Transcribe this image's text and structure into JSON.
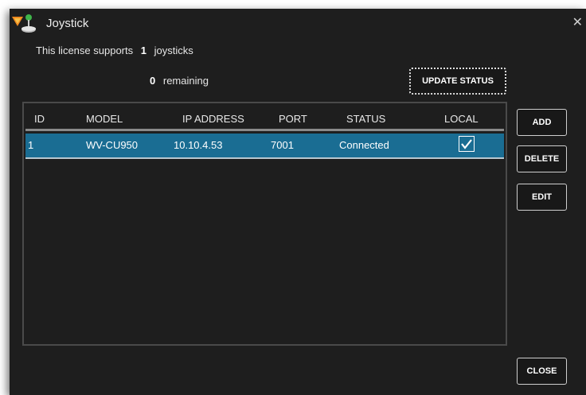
{
  "window": {
    "title": "Joystick",
    "close_glyph": "✕"
  },
  "license": {
    "supports_prefix": "This license supports",
    "supports_count": "1",
    "supports_suffix": "joysticks",
    "remaining_count": "0",
    "remaining_label": "remaining"
  },
  "buttons": {
    "update_status": "UPDATE STATUS",
    "add": "ADD",
    "delete": "DELETE",
    "edit": "EDIT",
    "close": "CLOSE"
  },
  "table": {
    "columns": [
      "ID",
      "MODEL",
      "IP ADDRESS",
      "PORT",
      "STATUS",
      "LOCAL"
    ],
    "rows": [
      {
        "id": "1",
        "model": "WV-CU950",
        "ip": "10.10.4.53",
        "port": "7001",
        "status": "Connected",
        "local": true
      }
    ]
  },
  "colors": {
    "background": "#1e1e1e",
    "selected_row": "#1a6d93",
    "border": "#cfcfcf"
  },
  "icons": {
    "app": "joystick-app-icon",
    "close": "close-icon",
    "check": "checkmark-icon"
  }
}
